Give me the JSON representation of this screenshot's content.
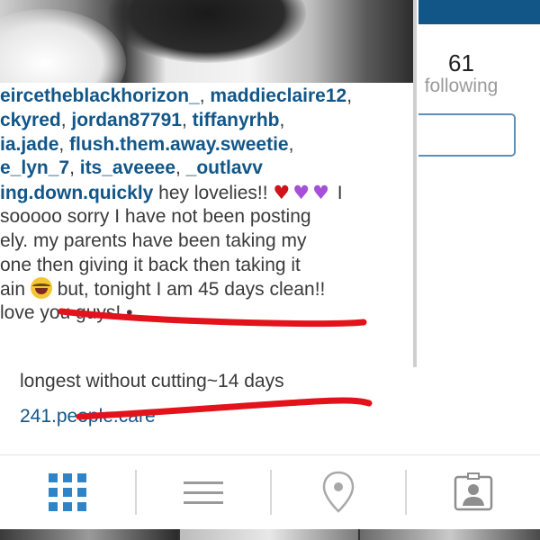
{
  "profile": {
    "following_count": "61",
    "following_label": "following"
  },
  "caption": {
    "lines": [
      [
        {
          "t": "link",
          "v": "eircetheblackhorizon_"
        },
        {
          "t": "text",
          "v": ", "
        },
        {
          "t": "link",
          "v": "maddieclaire12"
        },
        {
          "t": "text",
          "v": ","
        }
      ],
      [
        {
          "t": "link",
          "v": "ckyred"
        },
        {
          "t": "text",
          "v": ", "
        },
        {
          "t": "link",
          "v": "jordan87791"
        },
        {
          "t": "text",
          "v": ", "
        },
        {
          "t": "link",
          "v": "tiffanyrhb"
        },
        {
          "t": "text",
          "v": ","
        }
      ],
      [
        {
          "t": "link",
          "v": "ia.jade"
        },
        {
          "t": "text",
          "v": ", "
        },
        {
          "t": "link",
          "v": "flush.them.away.sweetie"
        },
        {
          "t": "text",
          "v": ","
        }
      ],
      [
        {
          "t": "link",
          "v": "e_lyn_7"
        },
        {
          "t": "text",
          "v": ", "
        },
        {
          "t": "link",
          "v": "its_aveeee"
        },
        {
          "t": "text",
          "v": ", "
        },
        {
          "t": "link",
          "v": "_outlavv"
        }
      ],
      [
        {
          "t": "link",
          "v": "ing.down.quickly"
        },
        {
          "t": "text",
          "v": " hey lovelies!! "
        },
        {
          "t": "emoji",
          "v": "red-heart"
        },
        {
          "t": "emoji",
          "v": "purple-heart"
        },
        {
          "t": "emoji",
          "v": "purple-heart"
        },
        {
          "t": "text",
          "v": " I"
        }
      ],
      [
        {
          "t": "text",
          "v": " sooooo sorry I have not been posting"
        }
      ],
      [
        {
          "t": "text",
          "v": "ely. my parents have been taking my"
        }
      ],
      [
        {
          "t": "text",
          "v": "one then giving it back then taking it"
        }
      ],
      [
        {
          "t": "text",
          "v": "ain "
        },
        {
          "t": "emoji",
          "v": "laughing-face"
        },
        {
          "t": "text",
          "v": " but, tonight I am 45 days clean!!"
        }
      ],
      [
        {
          "t": "text",
          "v": " love you guys! •"
        }
      ]
    ]
  },
  "stat_line": "longest without cutting~14 days",
  "site_link": "241.people.care",
  "tabs": [
    {
      "name": "tab-grid",
      "icon": "grid-icon"
    },
    {
      "name": "tab-list",
      "icon": "list-icon"
    },
    {
      "name": "tab-location",
      "icon": "location-pin-icon"
    },
    {
      "name": "tab-tagged",
      "icon": "tagged-person-icon"
    }
  ],
  "colors": {
    "link": "#125688",
    "accent": "#2f84c8",
    "marker": "#e3121b",
    "top_bar": "#125688"
  }
}
